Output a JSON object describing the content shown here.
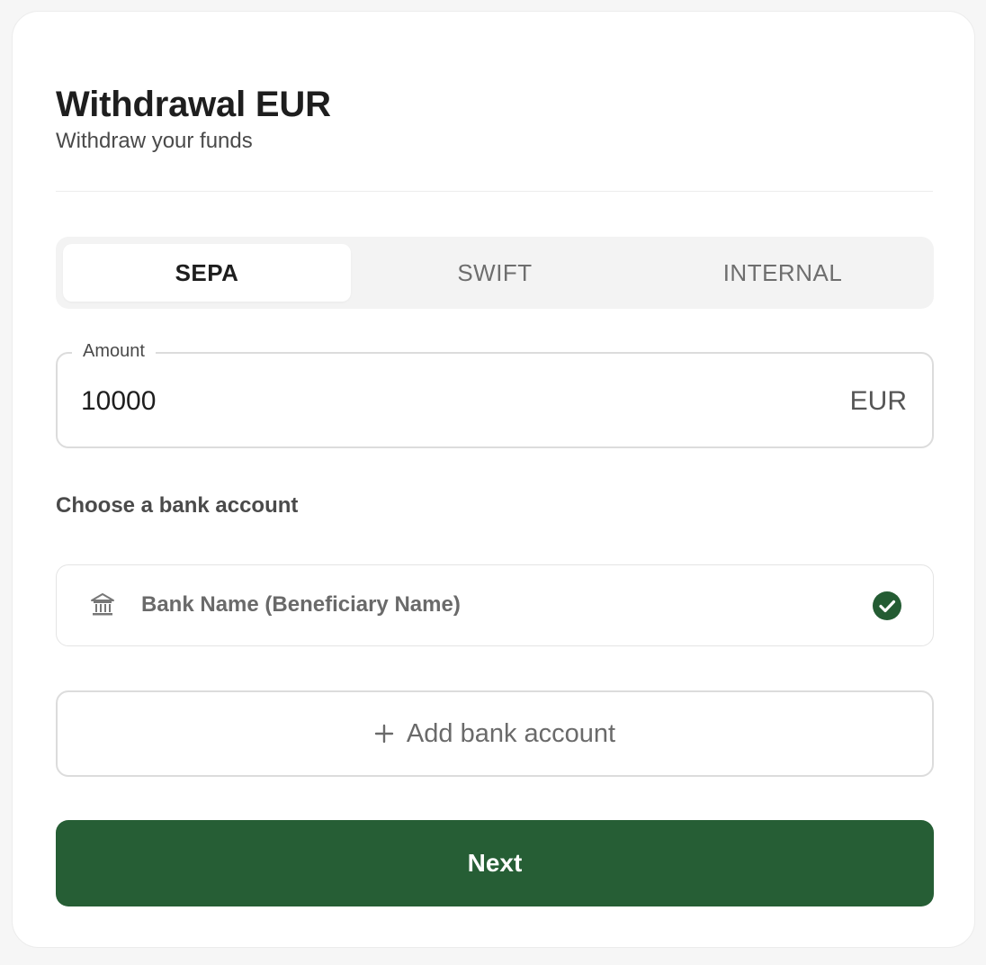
{
  "header": {
    "title": "Withdrawal EUR",
    "subtitle": "Withdraw your funds"
  },
  "tabs": [
    {
      "label": "SEPA",
      "active": true
    },
    {
      "label": "SWIFT",
      "active": false
    },
    {
      "label": "INTERNAL",
      "active": false
    }
  ],
  "amount": {
    "label": "Amount",
    "value": "10000",
    "currency": "EUR"
  },
  "bank_section": {
    "label": "Choose a bank account",
    "accounts": [
      {
        "name": "Bank Name (Beneficiary Name)",
        "icon": "bank-icon",
        "selected": true
      }
    ],
    "add_label": "Add bank account",
    "add_icon": "plus-icon"
  },
  "actions": {
    "next_label": "Next"
  },
  "colors": {
    "accent": "#265e35",
    "check": "#245c33"
  }
}
